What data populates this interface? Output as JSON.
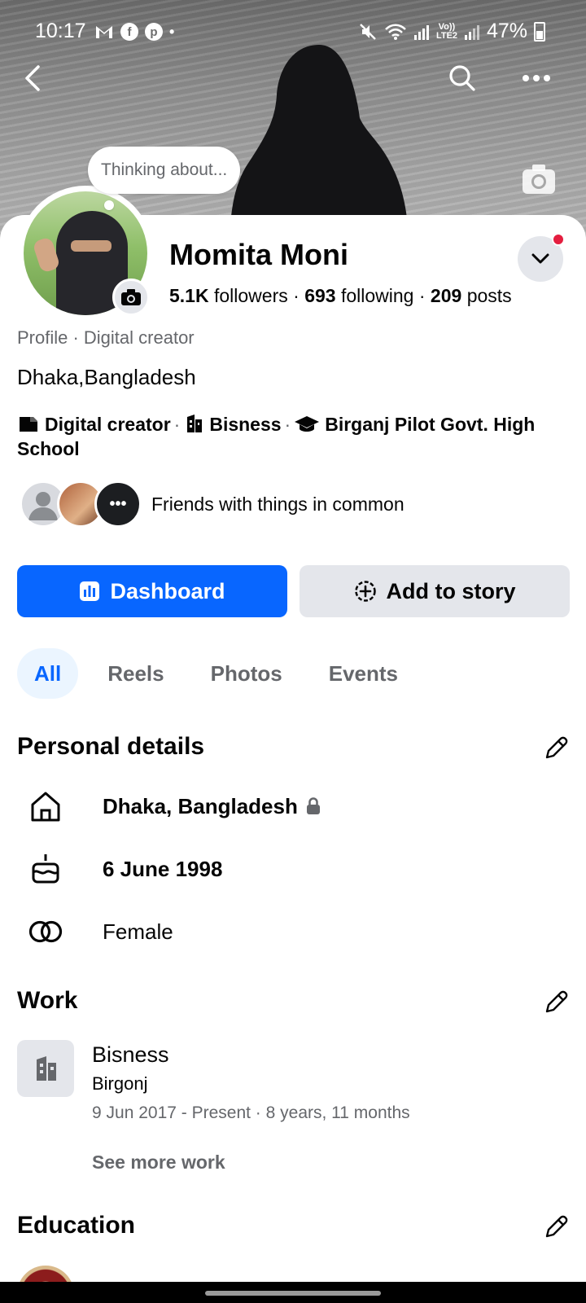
{
  "status_bar": {
    "time": "10:17",
    "battery": "47%",
    "left_icons": [
      "gmail-icon",
      "facebook-icon",
      "pinterest-icon",
      "dot-icon"
    ],
    "right_icons": [
      "mute-icon",
      "wifi-icon",
      "signal-icon",
      "volte-icon",
      "signal-icon"
    ],
    "volte_label": "Vo)) LTE2"
  },
  "header": {
    "icons": [
      "back-arrow-icon",
      "search-icon",
      "more-icon"
    ]
  },
  "thought_bubble": {
    "text": "Thinking about..."
  },
  "profile": {
    "name": "Momita Moni",
    "followers_count": "5.1K",
    "followers_label": "followers",
    "following_count": "693",
    "following_label": "following",
    "posts_count": "209",
    "posts_label": "posts",
    "separator": "·",
    "category": "Profile · Digital creator",
    "location": "Dhaka,Bangladesh",
    "badges": [
      {
        "icon": "creator-icon",
        "label": "Digital creator"
      },
      {
        "icon": "building-icon",
        "label": "Bisness"
      },
      {
        "icon": "graduation-cap-icon",
        "label": "Birganj Pilot Govt. High School"
      }
    ],
    "mutual_text": "Friends with things in common"
  },
  "actions": {
    "dashboard_label": "Dashboard",
    "add_story_label": "Add to story"
  },
  "tabs": [
    {
      "label": "All",
      "active": true
    },
    {
      "label": "Reels",
      "active": false
    },
    {
      "label": "Photos",
      "active": false
    },
    {
      "label": "Events",
      "active": false
    }
  ],
  "personal_details": {
    "title": "Personal details",
    "items": [
      {
        "icon": "home-icon",
        "text": "Dhaka, Bangladesh",
        "private": true
      },
      {
        "icon": "cake-icon",
        "text": "6 June 1998"
      },
      {
        "icon": "gender-icon",
        "text": "Female"
      }
    ]
  },
  "work": {
    "title": "Work",
    "job_title": "Bisness",
    "place": "Birgonj",
    "dates": "9 Jun 2017 - Present · 8 years, 11 months",
    "see_more": "See more work"
  },
  "education": {
    "title": "Education"
  },
  "colors": {
    "primary": "#0866ff",
    "secondary_bg": "#e4e6eb",
    "muted_text": "#65676b",
    "notification": "#e41e3f",
    "tab_active_bg": "#ebf5ff"
  }
}
